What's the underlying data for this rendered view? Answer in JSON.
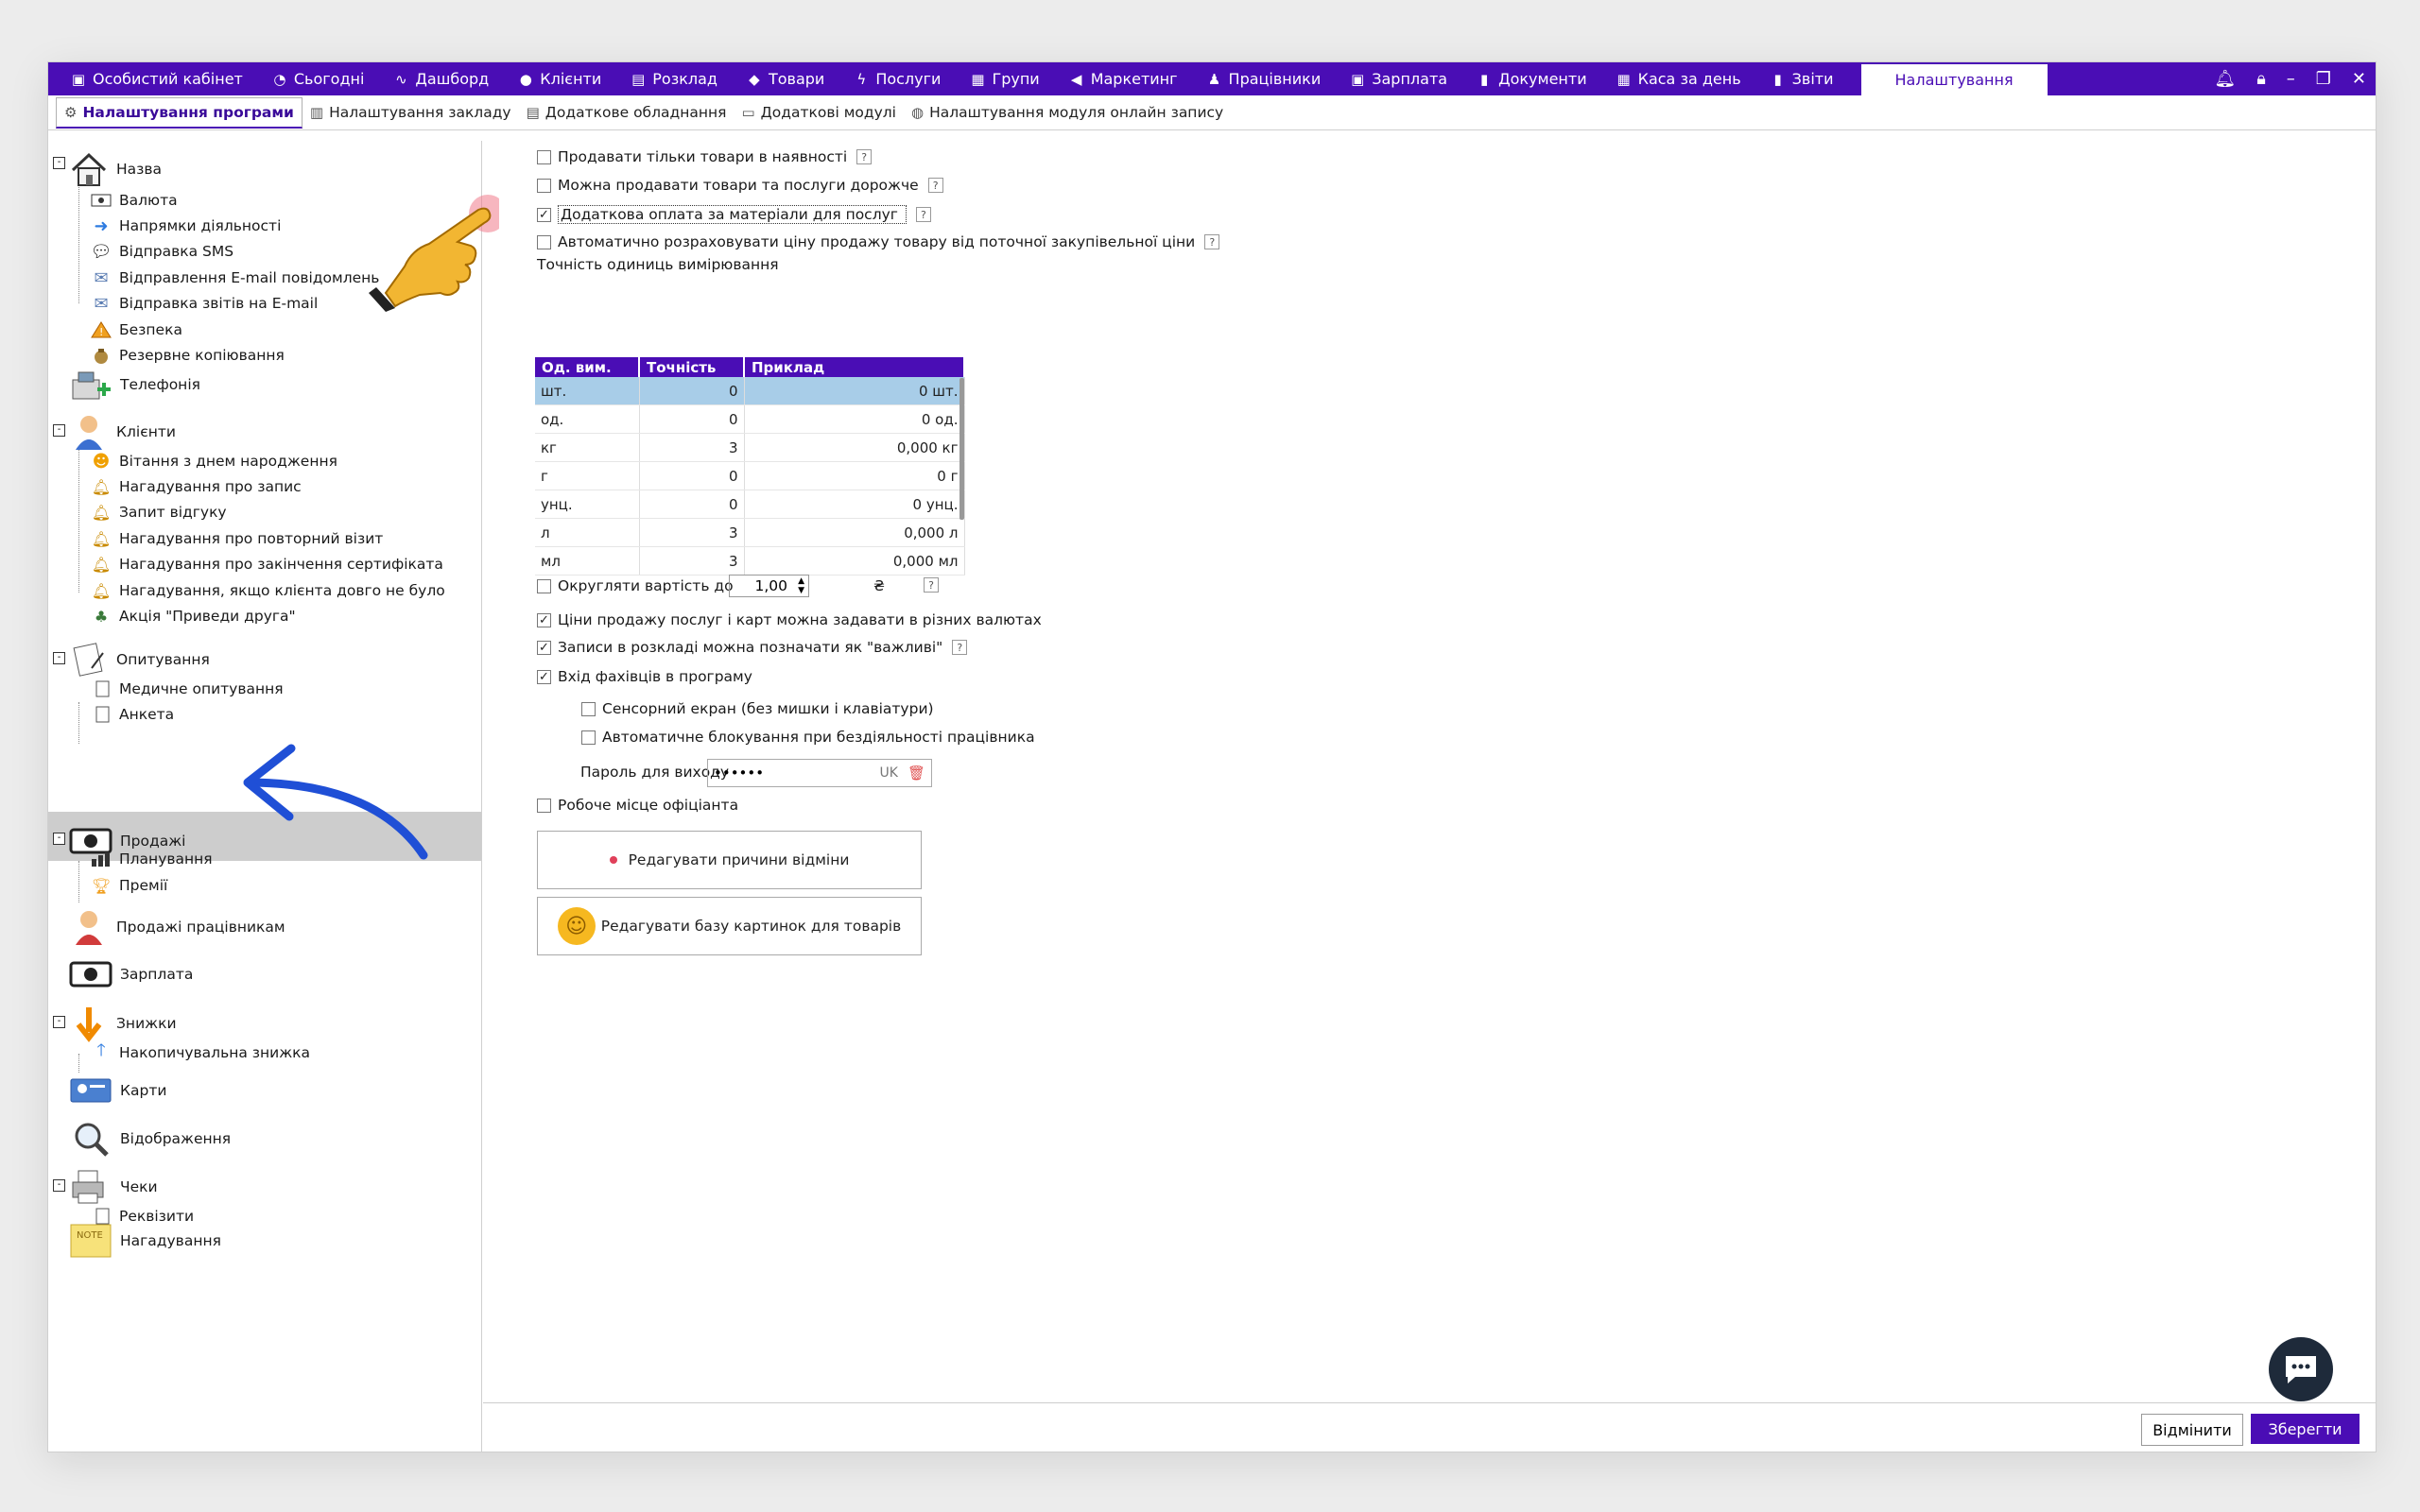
{
  "nav": {
    "items": [
      {
        "label": "Особистий кабінет",
        "icon": "cash-register-icon"
      },
      {
        "label": "Сьогодні",
        "icon": "clock-icon"
      },
      {
        "label": "Дашборд",
        "icon": "pulse-icon"
      },
      {
        "label": "Клієнти",
        "icon": "user-circle-icon"
      },
      {
        "label": "Розклад",
        "icon": "calendar-icon"
      },
      {
        "label": "Товари",
        "icon": "box-icon"
      },
      {
        "label": "Послуги",
        "icon": "bolt-icon"
      },
      {
        "label": "Групи",
        "icon": "group-icon"
      },
      {
        "label": "Маркетинг",
        "icon": "megaphone-icon"
      },
      {
        "label": "Працівники",
        "icon": "worker-icon"
      },
      {
        "label": "Зарплата",
        "icon": "money-icon"
      },
      {
        "label": "Документи",
        "icon": "document-icon"
      },
      {
        "label": "Каса за день",
        "icon": "calculator-icon"
      },
      {
        "label": "Звіти",
        "icon": "bar-chart-icon"
      }
    ],
    "active_label": "Налаштування"
  },
  "subtabs": [
    {
      "label": "Налаштування програми",
      "icon": "gear-icon"
    },
    {
      "label": "Налаштування закладу",
      "icon": "building-icon"
    },
    {
      "label": "Додаткове обладнання",
      "icon": "printer-icon"
    },
    {
      "label": "Додаткові модулі",
      "icon": "window-icon"
    },
    {
      "label": "Налаштування модуля онлайн запису",
      "icon": "globe-icon"
    }
  ],
  "sidebar": {
    "nazva": "Назва",
    "valyuta": "Валюта",
    "napryamky": "Напрямки діяльності",
    "sms": "Відправка SMS",
    "email_notif": "Відправлення E-mail повідомлень",
    "email_reports": "Відправка звітів на E-mail",
    "bezpeka": "Безпека",
    "backup": "Резервне копіювання",
    "telefoniya": "Телефонія",
    "klienty": "Клієнти",
    "birthday": "Вітання з днем народження",
    "remind_record": "Нагадування про запис",
    "review": "Запит відгуку",
    "remind_repeat": "Нагадування про повторний візит",
    "remind_cert": "Нагадування про закінчення сертифіката",
    "remind_long": "Нагадування, якщо клієнта довго не було",
    "promo": "Акція \"Приведи друга\"",
    "opytuvannya": "Опитування",
    "medical": "Медичне опитування",
    "anketa": "Анкета",
    "prodazhi": "Продажі",
    "planuvannya": "Планування",
    "premii": "Премії",
    "prod_staff": "Продажі працівникам",
    "zarplata": "Зарплата",
    "znyzhky": "Знижки",
    "accum": "Накопичувальна знижка",
    "karty": "Карти",
    "vidobrazhennya": "Відображення",
    "cheky": "Чеки",
    "rekvizyty": "Реквізити",
    "nagaduvannya": "Нагадування",
    "note_icon_text": "NOTE"
  },
  "options": {
    "only_in_stock": {
      "label": "Продавати тільки товари в наявності",
      "checked": false
    },
    "sell_expensive": {
      "label": "Можна продавати товари та послуги дорожче",
      "checked": false
    },
    "extra_materials": {
      "label": "Додаткова оплата за матеріали для послуг",
      "checked": true
    },
    "auto_price": {
      "label": "Автоматично розраховувати ціну продажу товару від поточної закупівельної ціни",
      "checked": false
    },
    "precision_label": "Точність одиниць вимірювання",
    "rounding": {
      "label": "Округляти вартість до",
      "checked": false,
      "value": "1,00",
      "currency": "₴"
    },
    "multi_currency": {
      "label": "Ціни продажу послуг і карт можна задавати в різних валютах",
      "checked": true
    },
    "important": {
      "label": "Записи в розкладі можна позначати як \"важливі\"",
      "checked": true
    },
    "staff_login": {
      "label": "Вхід фахівців в програму",
      "checked": true
    },
    "touch_screen": {
      "label": "Сенсорний екран (без мишки і клавіатури)",
      "checked": false
    },
    "auto_lock": {
      "label": "Автоматичне блокування при бездіяльності працівника",
      "checked": false
    },
    "password_label": "Пароль для виходу",
    "password_value": "••••••",
    "password_lang": "UK",
    "waiter": {
      "label": "Робоче місце офіціанта",
      "checked": false
    },
    "help_mark": "?"
  },
  "units_table": {
    "headers": [
      "Од. вим.",
      "Точність",
      "Приклад"
    ],
    "rows": [
      [
        "шт.",
        "0",
        "0 шт."
      ],
      [
        "од.",
        "0",
        "0 од."
      ],
      [
        "кг",
        "3",
        "0,000 кг"
      ],
      [
        "г",
        "0",
        "0 г"
      ],
      [
        "унц.",
        "0",
        "0 унц."
      ],
      [
        "л",
        "3",
        "0,000 л"
      ],
      [
        "мл",
        "3",
        "0,000 мл"
      ]
    ]
  },
  "buttons": {
    "edit_reasons": "Редагувати причини відміни",
    "edit_images": "Редагувати базу картинок для товарів",
    "cancel": "Відмінити",
    "save": "Зберегти"
  },
  "colors": {
    "accent": "#4a0db5",
    "selected_row": "#a8cde8",
    "arrow": "#1f4fd6"
  }
}
